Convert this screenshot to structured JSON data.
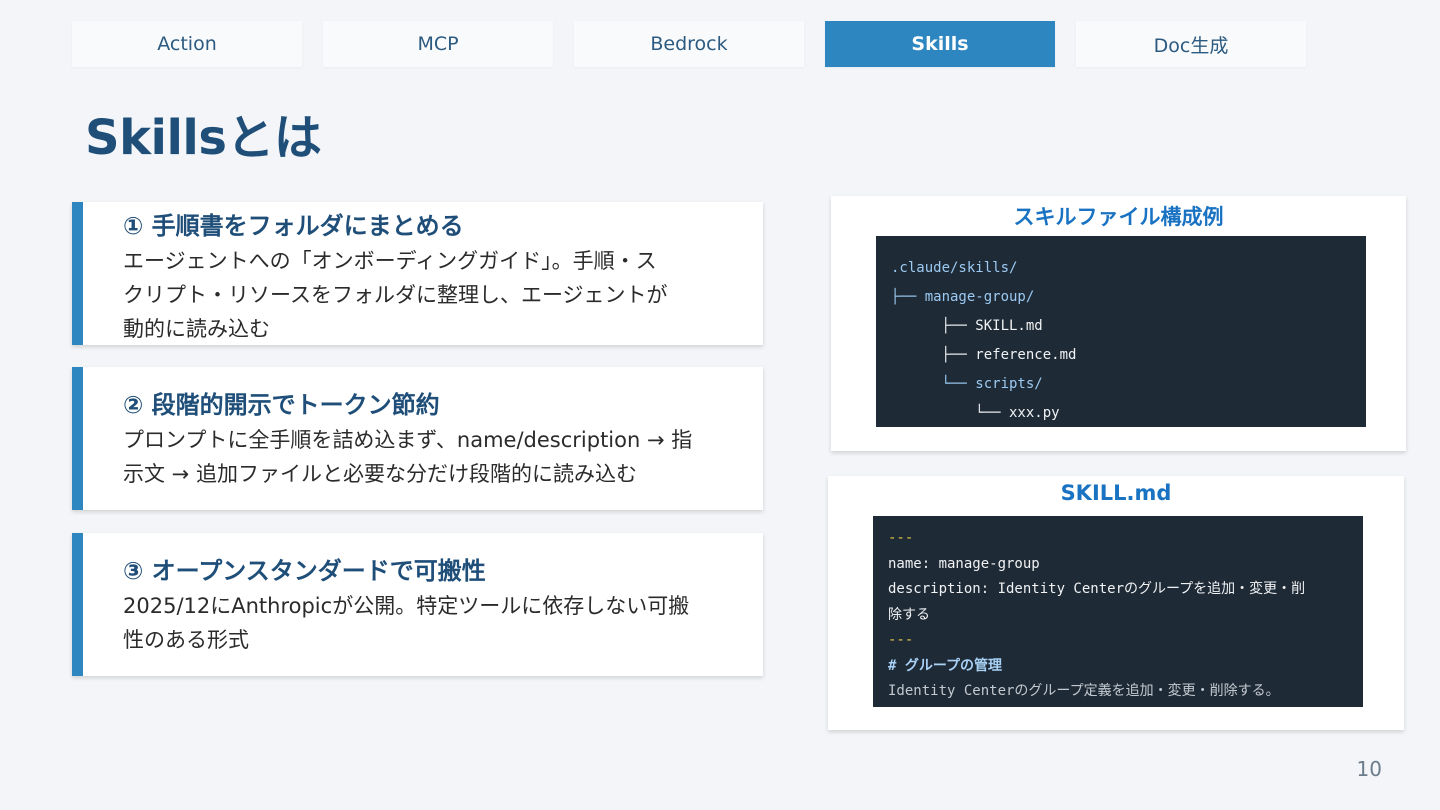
{
  "tabs": [
    "Action",
    "MCP",
    "Bedrock",
    "Skills",
    "Doc生成"
  ],
  "active_tab": "Skills",
  "title": "Skillsとは",
  "cards": [
    {
      "heading": "① 手順書をフォルダにまとめる",
      "body": [
        "エージェントへの「オンボーディングガイド」。手順・ス",
        "クリプト・リソースをフォルダに整理し、エージェントが",
        "動的に読み込む"
      ]
    },
    {
      "heading": "② 段階的開示でトークン節約",
      "body": [
        "プロンプトに全手順を詰め込まず、name/description → 指",
        "示文 → 追加ファイルと必要な分だけ段階的に読み込む"
      ]
    },
    {
      "heading": "③ オープンスタンダードで可搬性",
      "body": [
        "2025/12にAnthropicが公開。特定ツールに依存しない可搬",
        "性のある形式"
      ]
    }
  ],
  "structure_panel": {
    "title": "スキルファイル構成例",
    "lines": [
      ".claude/skills/",
      "├── manage-group/",
      "      ├── SKILL.md",
      "      ├── reference.md",
      "      └── scripts/",
      "          └── xxx.py"
    ]
  },
  "skill_panel": {
    "title": "SKILL.md",
    "lines": [
      "---",
      "name: manage-group",
      "description: Identity Centerのグループを追加・変更・削",
      "除する",
      "---",
      "# グループの管理",
      "Identity Centerのグループ定義を追加・変更・削除する。"
    ]
  },
  "page_number": "10"
}
